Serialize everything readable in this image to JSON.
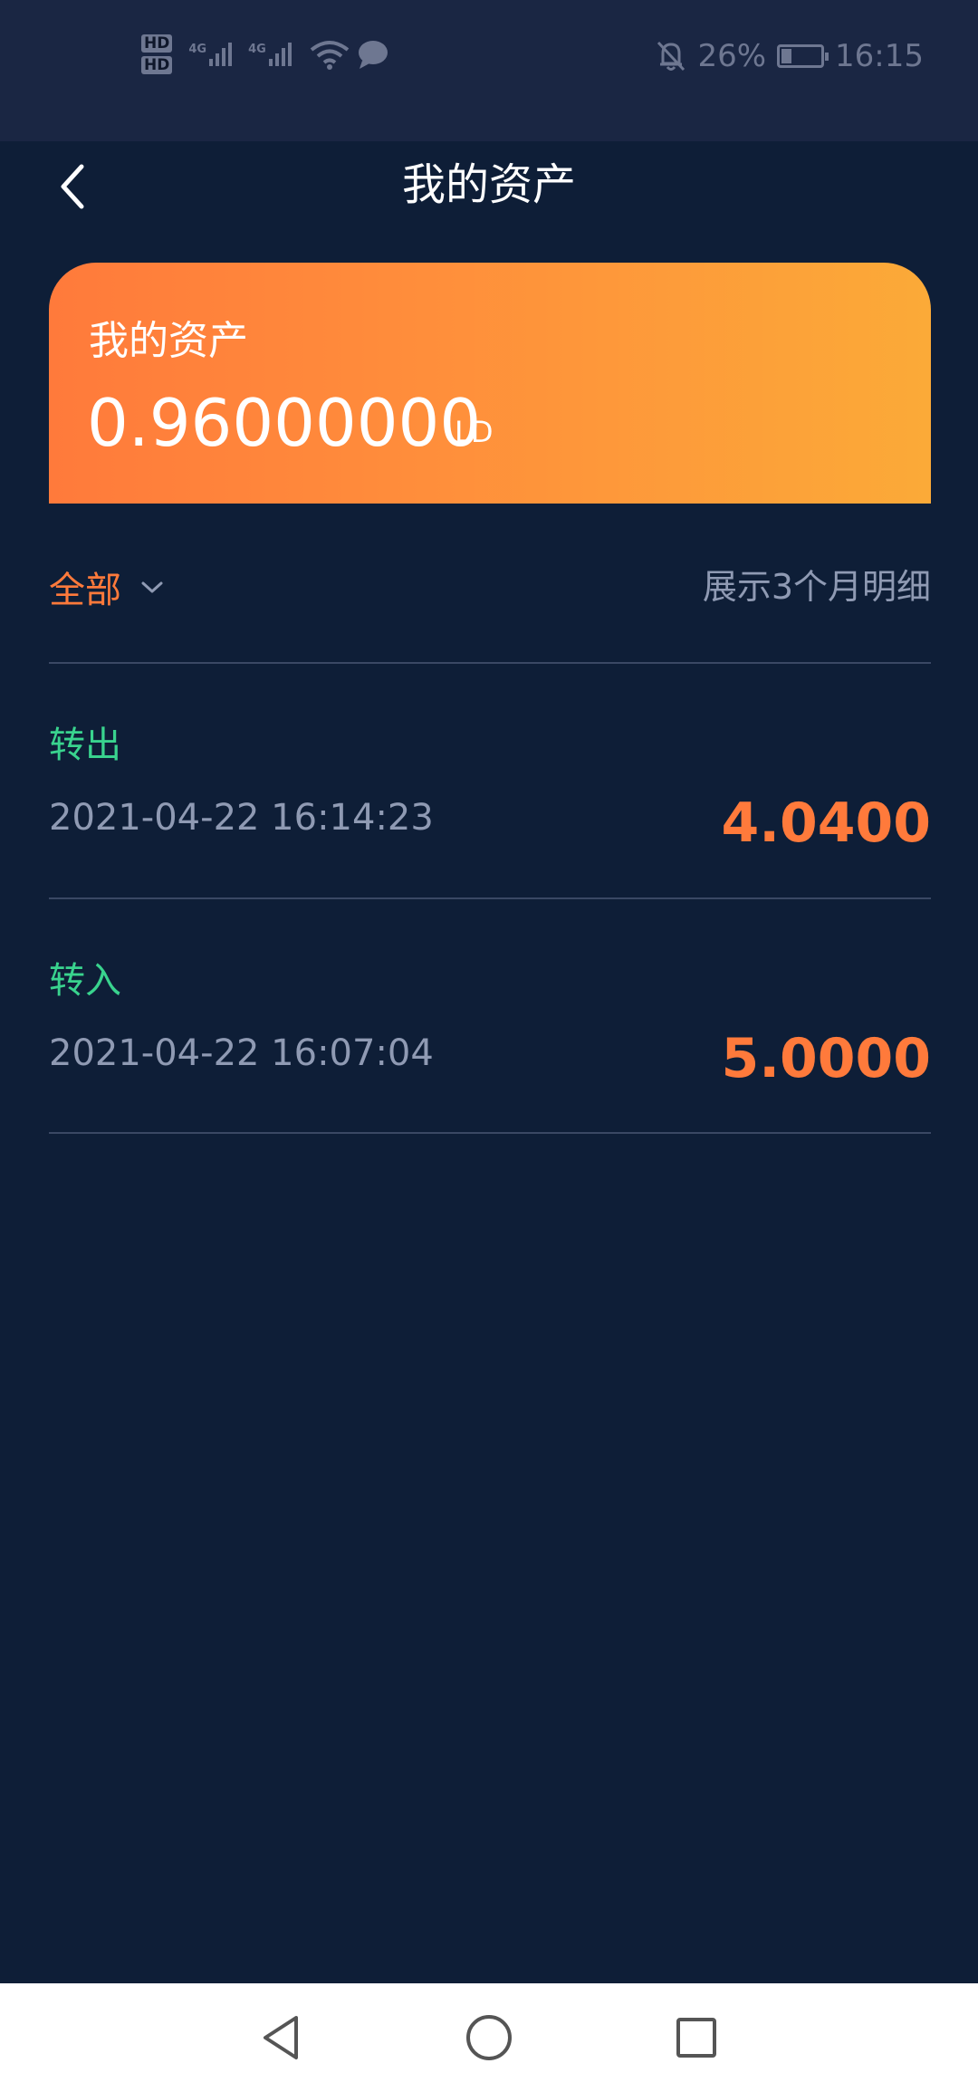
{
  "status_bar": {
    "sim1": "HD",
    "sim2": "HD",
    "network1": "4G",
    "network2": "4G",
    "battery_percent": "26%",
    "battery_level": 0.26,
    "time": "16:15",
    "icons": [
      "hd-icon",
      "signal-icon",
      "wifi-icon",
      "chat-icon",
      "mute-bell-icon",
      "battery-icon"
    ]
  },
  "header": {
    "title": "我的资产",
    "back_icon": "chevron-left-icon"
  },
  "asset_card": {
    "label": "我的资产",
    "amount": "0.96000000",
    "unit": "LD",
    "gradient": [
      "#ff7a3b",
      "#fbaa38"
    ]
  },
  "filter": {
    "selected": "全部",
    "dropdown_icon": "chevron-down-icon",
    "note": "展示3个月明细"
  },
  "records": [
    {
      "type": "转出",
      "time": "2021-04-22 16:14:23",
      "amount": "4.0400"
    },
    {
      "type": "转入",
      "time": "2021-04-22 16:07:04",
      "amount": "5.0000"
    }
  ],
  "colors": {
    "background": "#0e1e37",
    "accent": "#ff7a3b",
    "type_green": "#39d38e",
    "muted": "#8f9ab3"
  },
  "nav": {
    "icons": [
      "back-triangle-icon",
      "home-circle-icon",
      "recents-square-icon"
    ]
  }
}
